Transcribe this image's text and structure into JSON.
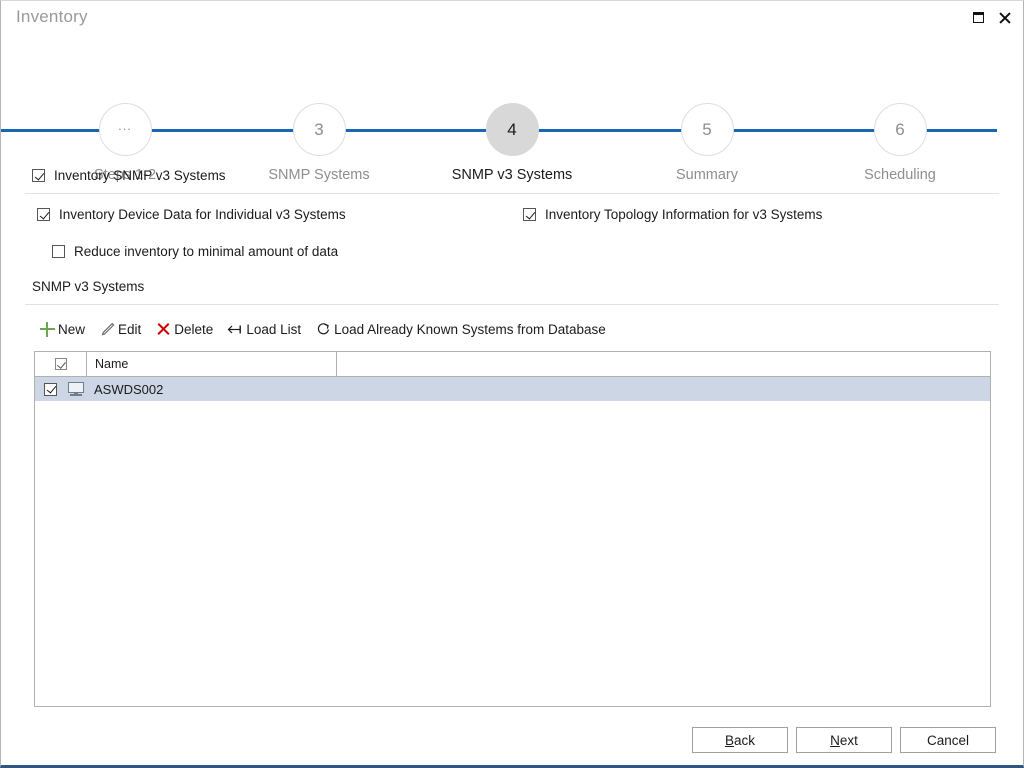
{
  "window": {
    "title": "Inventory",
    "controls": [
      {
        "name": "restore",
        "glyph": "restore-icon"
      },
      {
        "name": "close",
        "glyph": "close-icon"
      }
    ],
    "accent_color": "#30557f"
  },
  "stepper": {
    "line_color": "#1667b4",
    "active_index": 2,
    "steps": [
      {
        "number": "...",
        "label": "Steps 1-2",
        "state": "done"
      },
      {
        "number": "3",
        "label": "SNMP Systems",
        "state": "done"
      },
      {
        "number": "4",
        "label": "SNMP v3 Systems",
        "state": "active"
      },
      {
        "number": "5",
        "label": "Summary",
        "state": "upcoming"
      },
      {
        "number": "6",
        "label": "Scheduling",
        "state": "upcoming"
      }
    ]
  },
  "options": {
    "master": {
      "label": "Inventory SNMP v3 Systems",
      "checked": true
    },
    "left": {
      "label": "Inventory Device Data for Individual v3 Systems",
      "checked": true
    },
    "left_sub": {
      "label": "Reduce inventory to minimal amount of data",
      "checked": false
    },
    "right": {
      "label": "Inventory Topology Information for v3 Systems",
      "checked": true
    }
  },
  "section": {
    "title": "SNMP v3 Systems"
  },
  "toolbar": {
    "buttons": [
      {
        "label": "New",
        "icon": "plus-icon",
        "color": "#6aa84f"
      },
      {
        "label": "Edit",
        "icon": "pencil-icon",
        "color": "#6b6b6b"
      },
      {
        "label": "Delete",
        "icon": "x-icon",
        "color": "#cc0000"
      },
      {
        "label": "Load List",
        "icon": "arrow-to-bar-icon",
        "color": "#1b1b1b"
      },
      {
        "label": "Load Already Known Systems from Database",
        "icon": "refresh-icon",
        "color": "#1b1b1b"
      }
    ]
  },
  "table": {
    "select_all_checked": true,
    "columns": [
      {
        "key": "check",
        "label": ""
      },
      {
        "key": "name",
        "label": "Name"
      },
      {
        "key": "rest",
        "label": ""
      }
    ],
    "rows": [
      {
        "checked": true,
        "icon": "monitor-icon",
        "name": "ASWDS002",
        "selected": true
      }
    ],
    "selected_row_color": "#ccd6e4"
  },
  "footer": {
    "back": {
      "label": "Back",
      "accel": "B"
    },
    "next": {
      "label": "Next",
      "accel": "N"
    },
    "cancel": {
      "label": "Cancel",
      "accel": ""
    }
  }
}
